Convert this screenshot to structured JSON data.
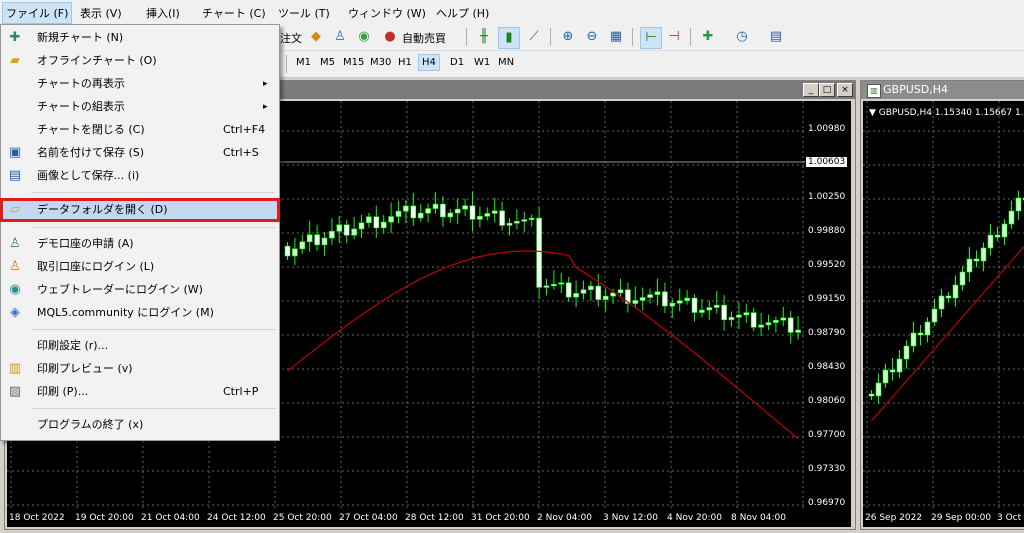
{
  "menubar": {
    "file": "ファイル (F)",
    "view": "表示 (V)",
    "insert": "挿入(I)",
    "chart": "チャート (C)",
    "tools": "ツール (T)",
    "window": "ウィンドウ (W)",
    "help": "ヘルプ (H)"
  },
  "toolbar": {
    "order_text": "注文",
    "autotrade_label": "自動売買"
  },
  "timeframes": [
    "M1",
    "M5",
    "M15",
    "M30",
    "H1",
    "H4",
    "D1",
    "W1",
    "MN"
  ],
  "selected_timeframe": "H4",
  "file_menu": {
    "items": [
      {
        "label": "新規チャート (N)",
        "icon": "new-chart-icon"
      },
      {
        "label": "オフラインチャート (O)",
        "icon": "open-folder-icon"
      },
      {
        "label": "チャートの再表示",
        "submenu": "▸"
      },
      {
        "label": "チャートの組表示",
        "submenu": "▸"
      },
      {
        "label": "チャートを閉じる (C)",
        "shortcut": "Ctrl+F4"
      },
      {
        "label": "名前を付けて保存 (S)",
        "shortcut": "Ctrl+S",
        "icon": "save-icon"
      },
      {
        "label": "画像として保存... (i)",
        "icon": "save-image-icon"
      },
      {
        "label": "データフォルダを開く (D)",
        "icon": "folder-icon",
        "highlighted": true
      },
      {
        "label": "デモ口座の申請 (A)",
        "icon": "demo-account-icon"
      },
      {
        "label": "取引口座にログイン (L)",
        "icon": "login-icon"
      },
      {
        "label": "ウェブトレーダーにログイン (W)",
        "icon": "web-trader-icon"
      },
      {
        "label": "MQL5.community にログイン (M)",
        "icon": "mql5-icon"
      },
      {
        "label": "印刷設定 (r)..."
      },
      {
        "label": "印刷プレビュー (v)",
        "icon": "print-preview-icon"
      },
      {
        "label": "印刷 (P)...",
        "shortcut": "Ctrl+P",
        "icon": "printer-icon"
      },
      {
        "label": "プログラムの終了 (x)"
      }
    ]
  },
  "main_chart": {
    "price_labels": [
      "1.00980",
      "1.00603",
      "1.00250",
      "0.99880",
      "0.99520",
      "0.99150",
      "0.98790",
      "0.98430",
      "0.98060",
      "0.97700",
      "0.97330",
      "0.96970"
    ],
    "current_price": "1.00603",
    "date_labels": [
      "18 Oct 2022",
      "19 Oct 20:00",
      "21 Oct 04:00",
      "24 Oct 12:00",
      "25 Oct 20:00",
      "27 Oct 04:00",
      "28 Oct 12:00",
      "31 Oct 20:00",
      "2 Nov 04:00",
      "3 Nov 12:00",
      "4 Nov 20:00",
      "8 Nov 04:00"
    ],
    "window_buttons": {
      "minimize": "_",
      "restore": "□",
      "close": "×"
    }
  },
  "right_chart": {
    "title": "GBPUSD,H4",
    "info": "▼ GBPUSD,H4  1.15340 1.15667 1.",
    "date_labels": [
      "26 Sep 2022",
      "29 Sep 00:00",
      "3 Oct"
    ]
  },
  "colors": {
    "bull_candle": "#ccffcc",
    "bear_candle": "#ffffff",
    "wick": "#00ff00",
    "moving_average": "#c00000",
    "chart_bg": "#000000",
    "grid": "#5a6a6a",
    "menu_highlight_border": "#e01b1b"
  }
}
